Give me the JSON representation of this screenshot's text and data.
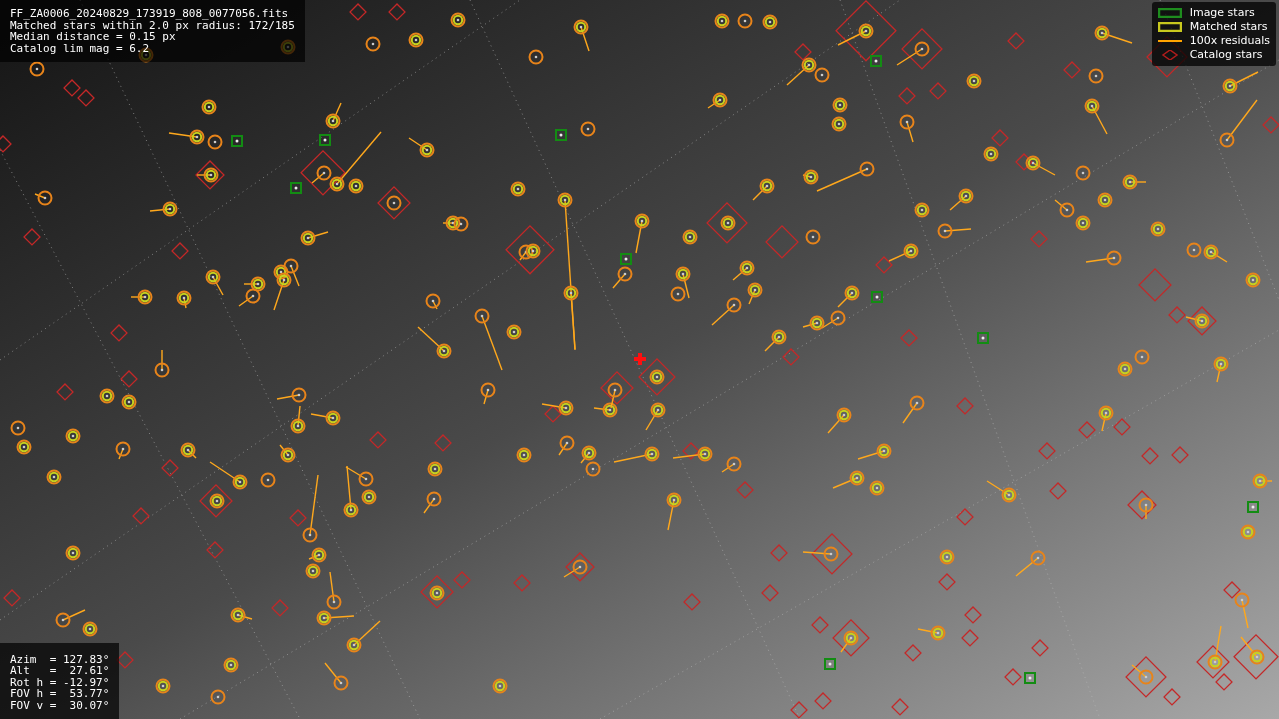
{
  "header": {
    "lines": [
      "FF_ZA0006_20240829_173919_808_0077056.fits",
      "Matched stars within 2.0 px radius: 172/185",
      "Median distance = 0.15 px",
      "Catalog lim mag = 6.2"
    ]
  },
  "legend": [
    {
      "label": "Image stars",
      "kind": "box",
      "color": "#1e8c1e"
    },
    {
      "label": "Matched stars",
      "kind": "box",
      "color": "#c8c81e"
    },
    {
      "label": "100x residuals",
      "kind": "line",
      "color": "#ffa500"
    },
    {
      "label": "Catalog stars",
      "kind": "diamond",
      "color": "#b01c1c"
    }
  ],
  "pointing": {
    "lines": [
      "Azim  = 127.83°",
      "Alt   =  27.61°",
      "Rot h = -12.97°",
      "FOV h =  53.77°",
      "FOV v =  30.07°"
    ]
  }
}
